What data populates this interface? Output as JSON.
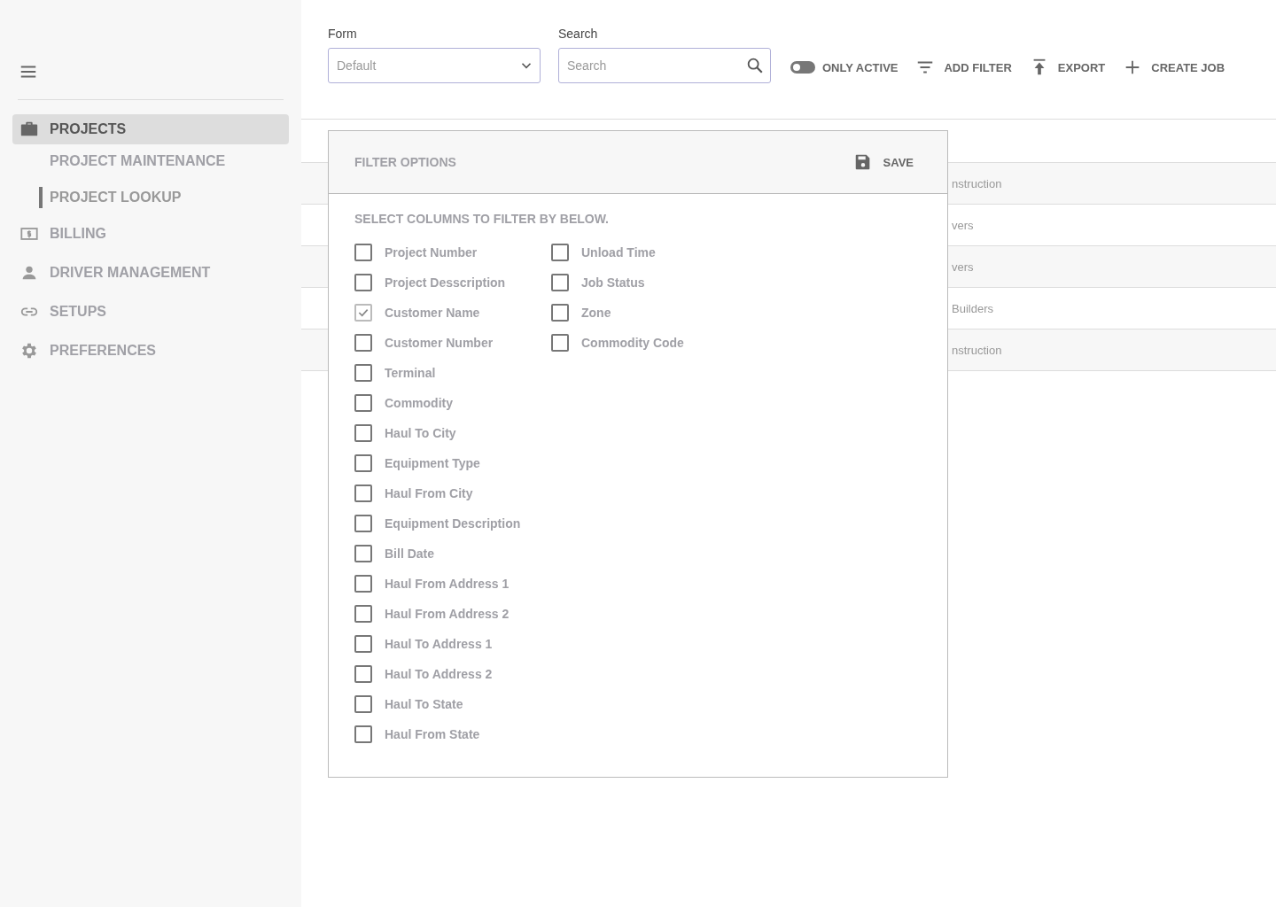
{
  "sidebar": {
    "items": [
      {
        "label": "PROJECTS",
        "selected": true,
        "children": [
          {
            "label": "PROJECT MAINTENANCE",
            "selected": false
          },
          {
            "label": "PROJECT LOOKUP",
            "selected": true
          }
        ]
      },
      {
        "label": "BILLING",
        "selected": false
      },
      {
        "label": "DRIVER MANAGEMENT",
        "selected": false
      },
      {
        "label": "SETUPS",
        "selected": false
      },
      {
        "label": "PREFERENCES",
        "selected": false
      }
    ]
  },
  "toolbar": {
    "form": {
      "label": "Form",
      "value": "Default"
    },
    "search": {
      "label": "Search",
      "placeholder": "Search"
    },
    "only_active": {
      "label": "ONLY ACTIVE",
      "on": false
    },
    "buttons": [
      "ADD FILTER",
      "EXPORT",
      "CREATE JOB"
    ]
  },
  "table": {
    "rows": [
      {
        "column_1": "nstruction"
      },
      {
        "column_1": "vers"
      },
      {
        "column_1": "vers"
      },
      {
        "column_1": "Builders"
      },
      {
        "column_1": "nstruction"
      }
    ]
  },
  "filter_panel": {
    "title": "FILTER OPTIONS",
    "save": "SAVE",
    "instruction": "SELECT COLUMNS TO FILTER BY BELOW.",
    "columns": [
      [
        {
          "label": "Project Number",
          "checked": false
        },
        {
          "label": "Project Desscription",
          "checked": false
        },
        {
          "label": "Customer Name",
          "checked": true
        },
        {
          "label": "Customer Number",
          "checked": false
        },
        {
          "label": "Terminal",
          "checked": false
        },
        {
          "label": "Commodity",
          "checked": false
        },
        {
          "label": "Haul To City",
          "checked": false
        },
        {
          "label": "Equipment Type",
          "checked": false
        },
        {
          "label": "Haul From City",
          "checked": false
        },
        {
          "label": "Equipment Description",
          "checked": false
        },
        {
          "label": "Bill Date",
          "checked": false
        },
        {
          "label": "Haul From Address 1",
          "checked": false
        },
        {
          "label": "Haul From Address 2",
          "checked": false
        },
        {
          "label": "Haul To Address 1",
          "checked": false
        },
        {
          "label": "Haul To Address 2",
          "checked": false
        },
        {
          "label": "Haul To State",
          "checked": false
        },
        {
          "label": "Haul From State",
          "checked": false
        }
      ],
      [
        {
          "label": "Unload Time",
          "checked": false
        },
        {
          "label": "Job Status",
          "checked": false
        },
        {
          "label": "Zone",
          "checked": false
        },
        {
          "label": "Commodity Code",
          "checked": false
        }
      ]
    ]
  }
}
